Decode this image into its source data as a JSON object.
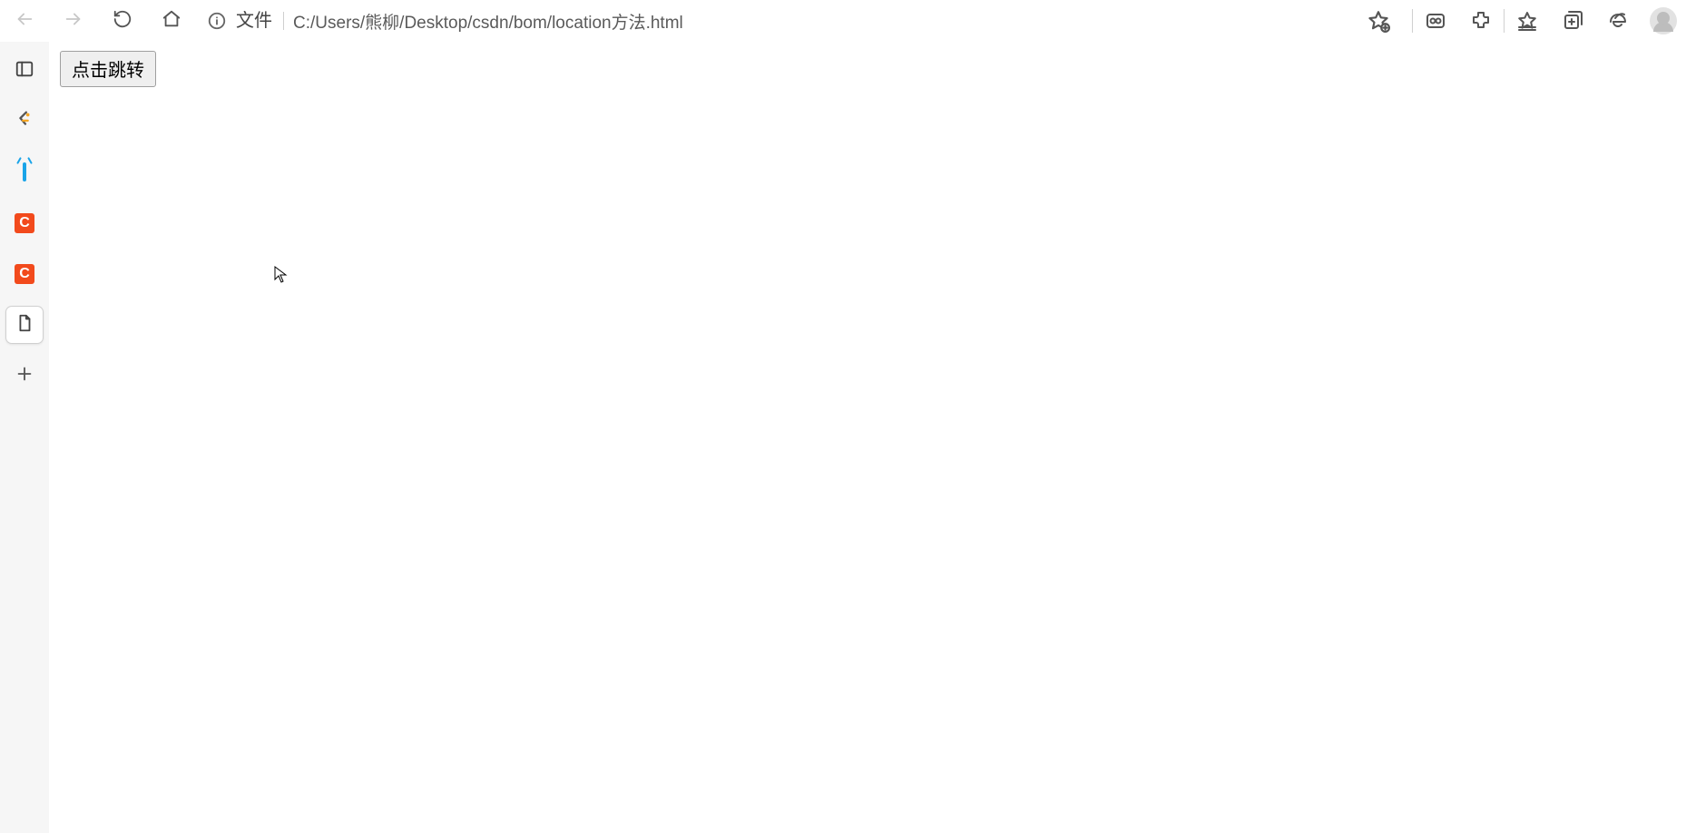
{
  "toolbar": {
    "address_type": "文件",
    "address_url": "C:/Users/熊柳/Desktop/csdn/bom/location方法.html"
  },
  "sidebar": {
    "items": [
      {
        "name": "panel"
      },
      {
        "name": "leetcode"
      },
      {
        "name": "bilibili"
      },
      {
        "name": "csdn1",
        "letter": "C"
      },
      {
        "name": "csdn2",
        "letter": "C"
      },
      {
        "name": "document"
      }
    ]
  },
  "page": {
    "button_label": "点击跳转"
  }
}
